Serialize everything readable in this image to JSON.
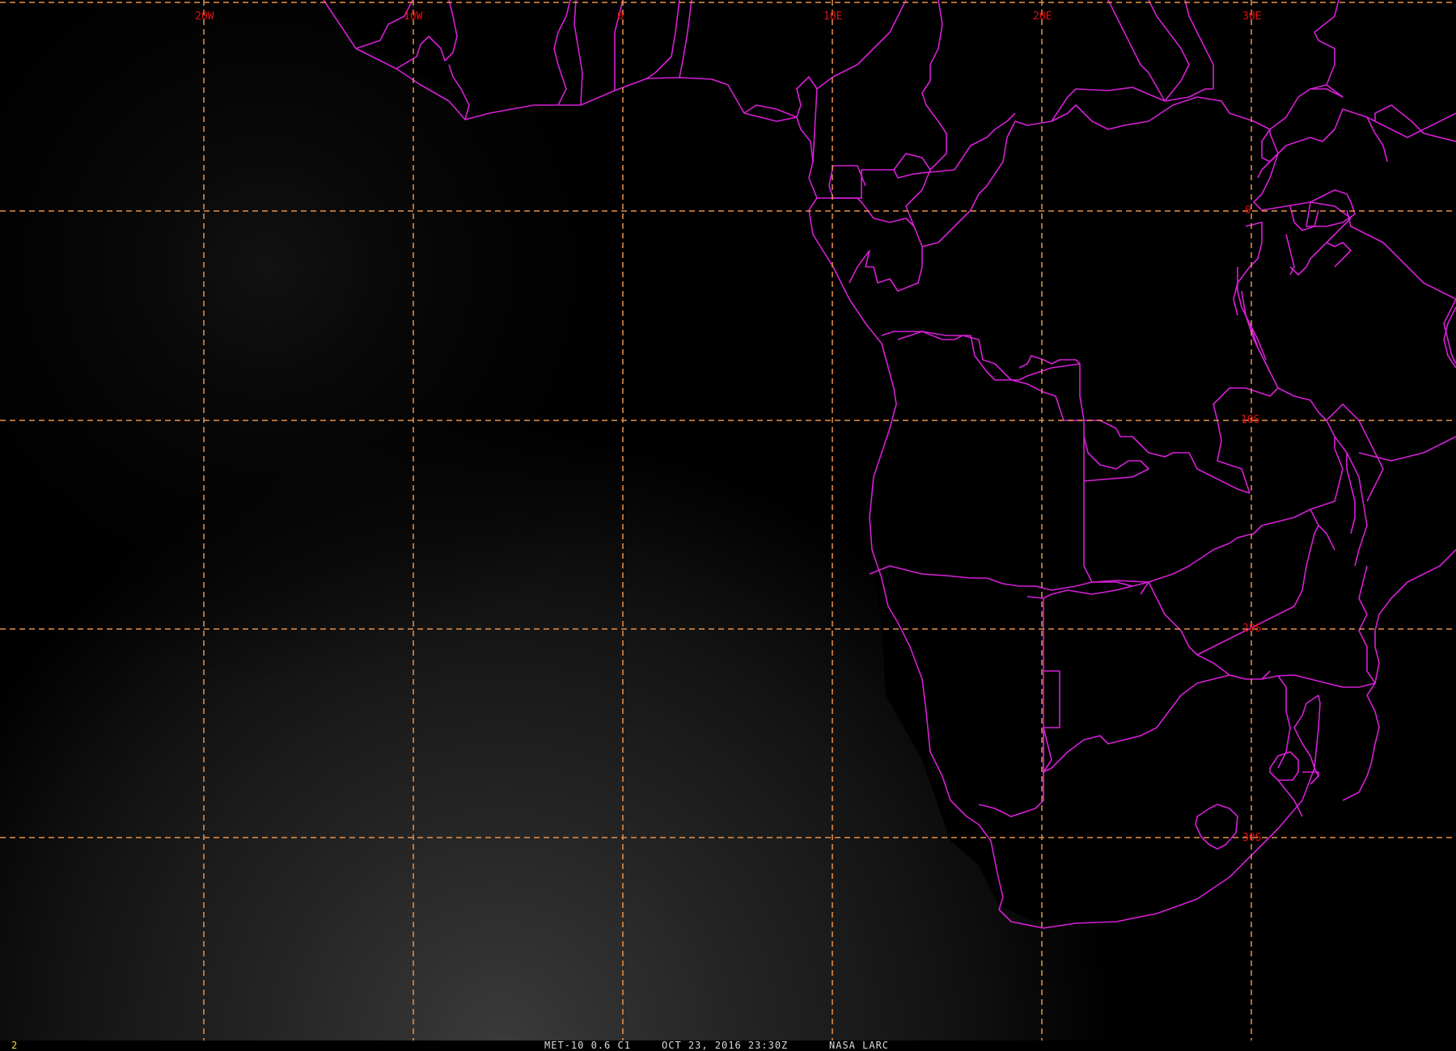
{
  "map": {
    "longitude_labels": [
      "20W",
      "10W",
      "0",
      "10E",
      "20E",
      "30E"
    ],
    "latitude_labels": [
      "0",
      "10S",
      "20S",
      "30S"
    ],
    "colors": {
      "background": "#000000",
      "grid": "#e8924a",
      "grid_label": "#e01010",
      "borders": "#d61fd6",
      "frame_number": "#f0e040"
    }
  },
  "status": {
    "frame_number": "2",
    "product": "MET-10 0.6 C1",
    "datetime": "OCT 23, 2016 23:30Z",
    "credit": "NASA LARC"
  }
}
